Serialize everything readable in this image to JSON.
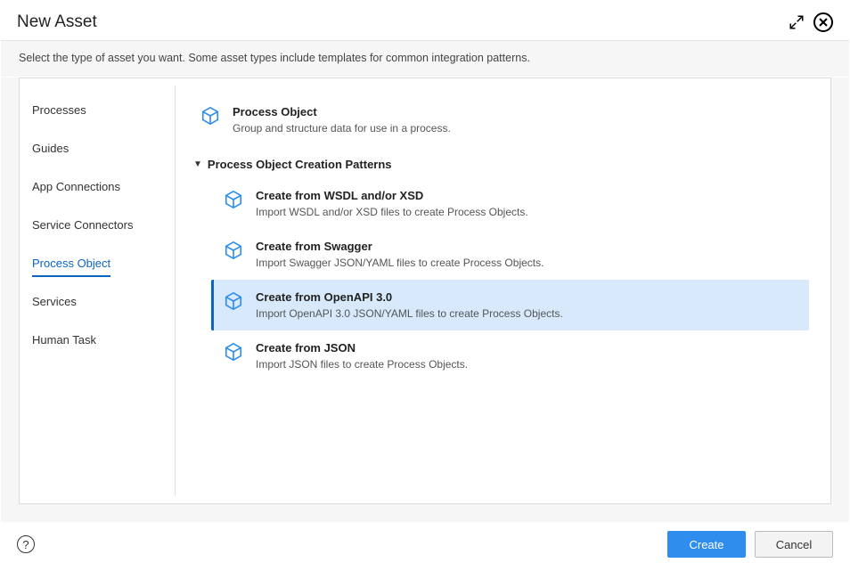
{
  "title": "New Asset",
  "description": "Select the type of asset you want. Some asset types include templates for common integration patterns.",
  "sidebar": {
    "items": [
      {
        "label": "Processes"
      },
      {
        "label": "Guides"
      },
      {
        "label": "App Connections"
      },
      {
        "label": "Service Connectors"
      },
      {
        "label": "Process Object"
      },
      {
        "label": "Services"
      },
      {
        "label": "Human Task"
      }
    ],
    "active_index": 4
  },
  "main": {
    "primary_option": {
      "title": "Process Object",
      "desc": "Group and structure data for use in a process."
    },
    "section_header": "Process Object Creation Patterns",
    "patterns": [
      {
        "title": "Create from WSDL and/or XSD",
        "desc": "Import WSDL and/or XSD files to create Process Objects."
      },
      {
        "title": "Create from Swagger",
        "desc": "Import Swagger JSON/YAML files to create Process Objects."
      },
      {
        "title": "Create from OpenAPI 3.0",
        "desc": "Import OpenAPI 3.0 JSON/YAML files to create Process Objects."
      },
      {
        "title": "Create from JSON",
        "desc": "Import JSON files to create Process Objects."
      }
    ],
    "selected_pattern_index": 2
  },
  "footer": {
    "help_glyph": "?",
    "create_label": "Create",
    "cancel_label": "Cancel"
  },
  "colors": {
    "accent": "#0b66c3",
    "primary_btn": "#2f8eed",
    "selection_bg": "#d7e9fb"
  }
}
